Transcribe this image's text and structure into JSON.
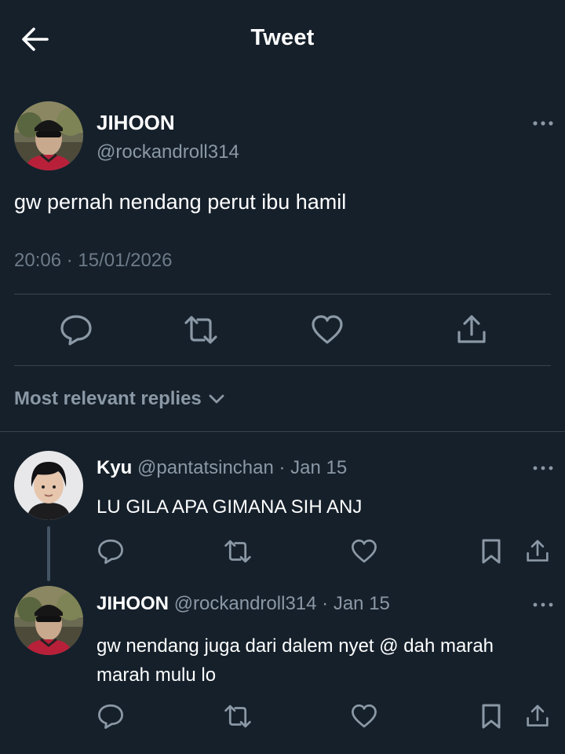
{
  "header": {
    "title": "Tweet",
    "back_icon": "arrow-left-icon"
  },
  "main_tweet": {
    "display_name": "JIHOON",
    "handle": "@rockandroll314",
    "text": "gw pernah nendang perut ibu hamil",
    "timestamp": "20:06 · 15/01/2026",
    "actions": [
      "reply-icon",
      "retweet-icon",
      "like-icon",
      "share-icon"
    ]
  },
  "replies_sort": {
    "label": "Most relevant replies"
  },
  "replies": [
    {
      "display_name": "Kyu",
      "handle": "@pantatsinchan",
      "separator": "·",
      "date": "Jan 15",
      "text": "LU GILA APA GIMANA SIH ANJ"
    },
    {
      "display_name": "JIHOON",
      "handle": "@rockandroll314",
      "separator": "·",
      "date": "Jan 15",
      "text": "gw nendang juga dari dalem nyet @ dah marah marah mulu lo"
    }
  ],
  "colors": {
    "background": "#15202b",
    "secondary_text": "#8b98a5",
    "divider": "#38444d",
    "icon": "#8b98a5"
  }
}
